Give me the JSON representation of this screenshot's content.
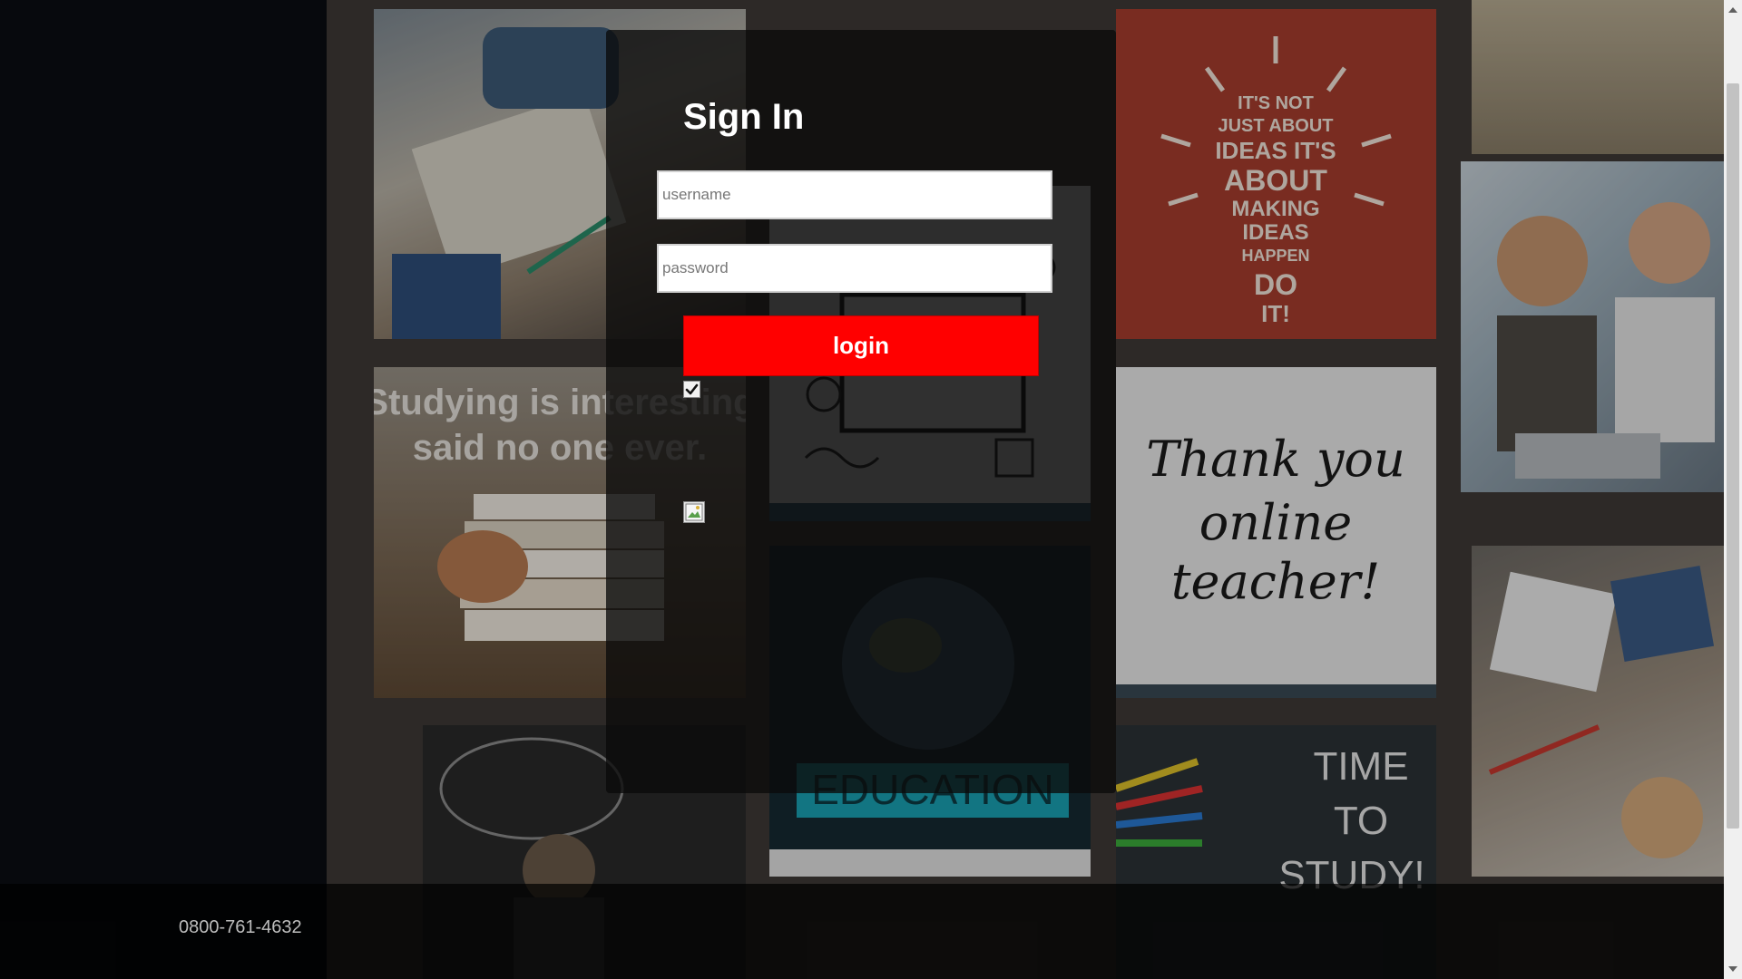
{
  "form": {
    "title": "Sign In",
    "username_placeholder": "username",
    "password_placeholder": "password",
    "login_label": "login",
    "remember_checked": true
  },
  "footer": {
    "phone": "0800-761-4632"
  },
  "colors": {
    "accent": "#ff0000",
    "panel": "#0a0a0a",
    "footer": "#000000"
  },
  "collage": {
    "tiles": [
      {
        "name": "student-writing-photo"
      },
      {
        "name": "studying-is-interesting-poster",
        "text": "Studying is interesting said no one ever."
      },
      {
        "name": "doodle-notebook-image"
      },
      {
        "name": "ideas-quote-poster",
        "text": "IT'S NOT JUST ABOUT IDEAS IT'S ABOUT MAKING IDEAS HAPPEN DO IT!"
      },
      {
        "name": "students-laptop-photo"
      },
      {
        "name": "thank-you-teacher-card",
        "text": "Thank you online teacher!"
      },
      {
        "name": "education-globe-image",
        "text": "EDUCATION"
      },
      {
        "name": "time-to-study-image",
        "text": "TIME TO STUDY!"
      },
      {
        "name": "thought-bubble-image"
      },
      {
        "name": "desk-supplies-photo"
      }
    ]
  }
}
